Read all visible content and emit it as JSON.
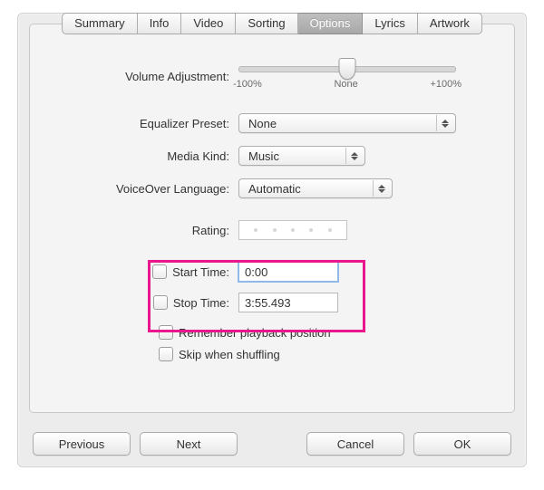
{
  "tabs": {
    "summary": "Summary",
    "info": "Info",
    "video": "Video",
    "sorting": "Sorting",
    "options": "Options",
    "lyrics": "Lyrics",
    "artwork": "Artwork",
    "selected": "options"
  },
  "labels": {
    "volume_adjustment": "Volume Adjustment:",
    "equalizer_preset": "Equalizer Preset:",
    "media_kind": "Media Kind:",
    "voiceover_language": "VoiceOver Language:",
    "rating": "Rating:",
    "start_time": "Start Time:",
    "stop_time": "Stop Time:",
    "remember_playback": "Remember playback position",
    "skip_shuffling": "Skip when shuffling"
  },
  "values": {
    "equalizer_preset": "None",
    "media_kind": "Music",
    "voiceover_language": "Automatic",
    "start_time": "0:00",
    "stop_time": "3:55.493"
  },
  "slider": {
    "min_label": "-100%",
    "mid_label": "None",
    "max_label": "+100%",
    "value_pct": 50
  },
  "buttons": {
    "previous": "Previous",
    "next": "Next",
    "cancel": "Cancel",
    "ok": "OK"
  }
}
